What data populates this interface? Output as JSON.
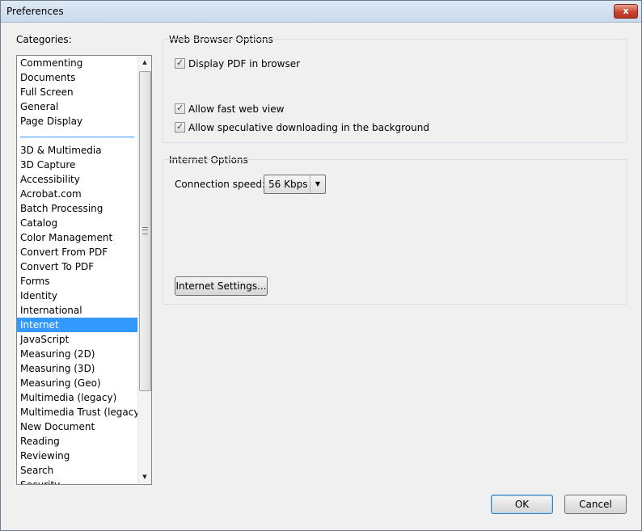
{
  "window": {
    "title": "Preferences",
    "close_glyph": "x"
  },
  "categories": {
    "label": "Categories:",
    "group1": [
      "Commenting",
      "Documents",
      "Full Screen",
      "General",
      "Page Display"
    ],
    "group2": [
      "3D & Multimedia",
      "3D Capture",
      "Accessibility",
      "Acrobat.com",
      "Batch Processing",
      "Catalog",
      "Color Management",
      "Convert From PDF",
      "Convert To PDF",
      "Forms",
      "Identity",
      "International",
      "Internet",
      "JavaScript",
      "Measuring (2D)",
      "Measuring (3D)",
      "Measuring (Geo)",
      "Multimedia (legacy)",
      "Multimedia Trust (legacy)",
      "New Document",
      "Reading",
      "Reviewing",
      "Search",
      "Security"
    ],
    "selected": "Internet",
    "scroll_up_glyph": "▲",
    "scroll_down_glyph": "▼"
  },
  "web_browser": {
    "title": "Web Browser Options",
    "display_pdf": {
      "label": "Display PDF in browser",
      "checked": true
    },
    "fast_web_view": {
      "label": "Allow fast web view",
      "checked": true
    },
    "speculative": {
      "label": "Allow speculative downloading in the background",
      "checked": true
    }
  },
  "internet": {
    "title": "Internet Options",
    "speed_label": "Connection speed:",
    "speed_value": "56 Kbps",
    "speed_arrow_glyph": "▼",
    "settings_button": "Internet Settings..."
  },
  "buttons": {
    "ok": "OK",
    "cancel": "Cancel"
  },
  "colors": {
    "selection": "#3399ff",
    "close_button": "#c9442f",
    "background": "#f0f0f0"
  }
}
